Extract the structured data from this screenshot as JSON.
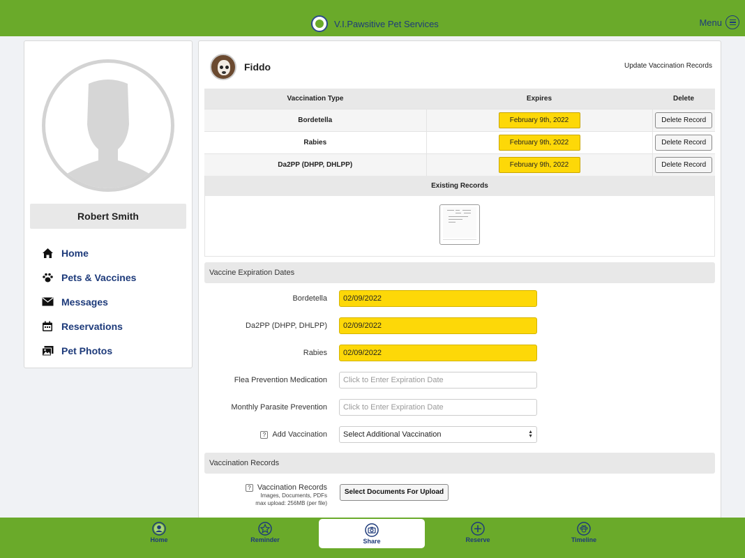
{
  "header": {
    "brand_name": "V.I.Pawsitive Pet Services",
    "menu_label": "Menu",
    "logo_icon": "brand-logo-icon",
    "colors": {
      "bar": "#6aaa2a",
      "text": "#1d3a7a"
    }
  },
  "profile": {
    "name": "Robert Smith",
    "avatar_icon": "default-user-avatar"
  },
  "sidebar": {
    "items": [
      {
        "label": "Home",
        "icon": "home-icon"
      },
      {
        "label": "Pets & Vaccines",
        "icon": "paw-icon"
      },
      {
        "label": "Messages",
        "icon": "envelope-icon"
      },
      {
        "label": "Reservations",
        "icon": "calendar-icon"
      },
      {
        "label": "Pet Photos",
        "icon": "photos-icon"
      }
    ]
  },
  "pet": {
    "name": "Fiddo",
    "update_link": "Update Vaccination Records"
  },
  "vaccination_table": {
    "headers": {
      "type": "Vaccination Type",
      "expires": "Expires",
      "delete": "Delete"
    },
    "rows": [
      {
        "type": "Bordetella",
        "expires": "February 9th, 2022",
        "action": "Delete Record"
      },
      {
        "type": "Rabies",
        "expires": "February 9th, 2022",
        "action": "Delete Record"
      },
      {
        "type": "Da2PP (DHPP, DHLPP)",
        "expires": "February 9th, 2022",
        "action": "Delete Record"
      }
    ],
    "existing_records_label": "Existing Records"
  },
  "expiration_section": {
    "title": "Vaccine Expiration Dates",
    "fields": [
      {
        "label": "Bordetella",
        "value": "02/09/2022",
        "placeholder": ""
      },
      {
        "label": "Da2PP (DHPP, DHLPP)",
        "value": "02/09/2022",
        "placeholder": ""
      },
      {
        "label": "Rabies",
        "value": "02/09/2022",
        "placeholder": ""
      },
      {
        "label": "Flea Prevention Medication",
        "value": "",
        "placeholder": "Click to Enter Expiration Date"
      },
      {
        "label": "Monthly Parasite Prevention",
        "value": "",
        "placeholder": "Click to Enter Expiration Date"
      }
    ],
    "add_vaccination": {
      "label": "Add Vaccination",
      "selected": "Select Additional Vaccination"
    },
    "highlight_color": "#fdd808"
  },
  "records_section": {
    "title": "Vaccination Records",
    "upload_label": "Vaccination Records",
    "upload_sub1": "Images, Documents, PDFs",
    "upload_sub2": "max upload: 256MB (per file)",
    "upload_button": "Select Documents For Upload"
  },
  "bottom_nav": {
    "items": [
      {
        "label": "Home",
        "icon": "user-circle-icon"
      },
      {
        "label": "Reminder",
        "icon": "star-circle-icon"
      },
      {
        "label": "Share",
        "icon": "camera-icon",
        "active": true
      },
      {
        "label": "Reserve",
        "icon": "plus-circle-icon"
      },
      {
        "label": "Timeline",
        "icon": "paw-circle-icon"
      }
    ]
  }
}
